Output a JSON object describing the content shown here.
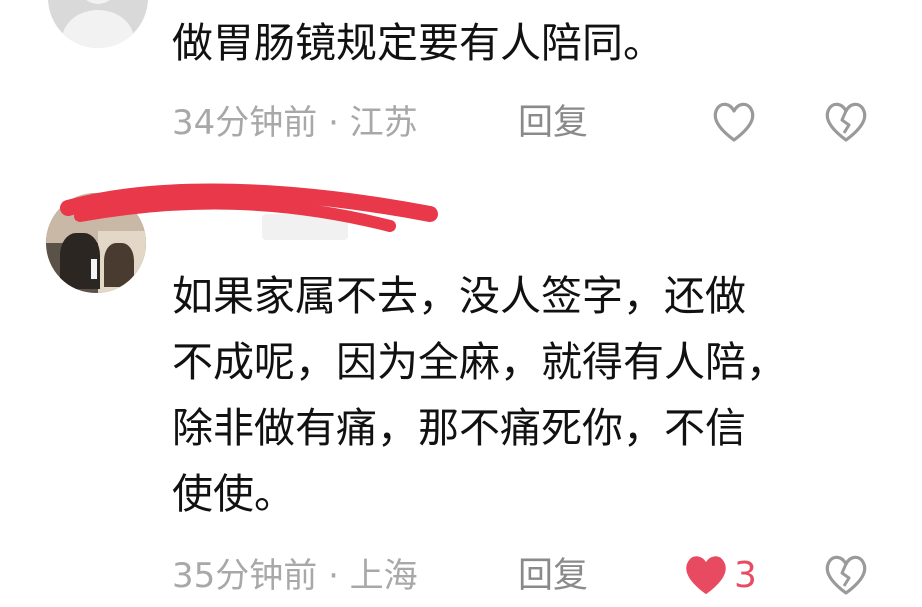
{
  "comments": [
    {
      "text": "做胃肠镜规定要有人陪同。",
      "meta": "34分钟前 · 江苏",
      "reply_label": "回复",
      "liked": false
    },
    {
      "text": "如果家属不去，没人签字，还做\n不成呢，因为全麻，就得有人陪，\n除非做有痛，那不痛死你，不信\n使使。",
      "meta": "35分钟前 · 上海",
      "reply_label": "回复",
      "liked": true,
      "like_count": "3"
    }
  ],
  "icons": {
    "like": "heart-outline-icon",
    "liked": "heart-filled-icon",
    "dislike": "broken-heart-icon"
  },
  "colors": {
    "liked": "#e84a62",
    "meta": "#a8a8a8",
    "redaction": "#e8384a"
  }
}
